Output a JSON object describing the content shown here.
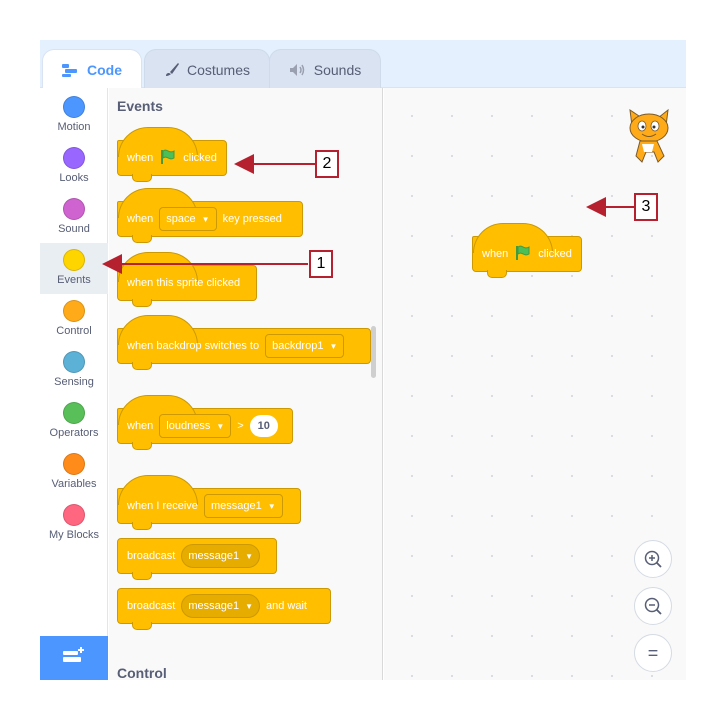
{
  "tabs": [
    {
      "label": "Code",
      "icon": "code-icon",
      "active": true
    },
    {
      "label": "Costumes",
      "icon": "brush-icon",
      "active": false
    },
    {
      "label": "Sounds",
      "icon": "speaker-icon",
      "active": false
    }
  ],
  "categories": [
    {
      "label": "Motion",
      "color": "#4c97ff"
    },
    {
      "label": "Looks",
      "color": "#9966ff"
    },
    {
      "label": "Sound",
      "color": "#cf63cf"
    },
    {
      "label": "Events",
      "color": "#ffd500",
      "active": true
    },
    {
      "label": "Control",
      "color": "#ffab19"
    },
    {
      "label": "Sensing",
      "color": "#5cb1d6"
    },
    {
      "label": "Operators",
      "color": "#59c059"
    },
    {
      "label": "Variables",
      "color": "#ff8c1a"
    },
    {
      "label": "My Blocks",
      "color": "#ff6680"
    }
  ],
  "palette": {
    "section_title": "Events",
    "next_section_title": "Control",
    "blocks": {
      "green_flag": {
        "when": "when",
        "clicked": "clicked"
      },
      "key_pressed": {
        "when": "when",
        "key": "space",
        "suffix": "key pressed"
      },
      "sprite_clicked": {
        "label": "when this sprite clicked"
      },
      "backdrop_switch": {
        "label": "when backdrop switches to",
        "value": "backdrop1"
      },
      "loudness": {
        "when": "when",
        "sensor": "loudness",
        "op": ">",
        "value": "10"
      },
      "receive": {
        "label": "when I receive",
        "message": "message1"
      },
      "broadcast": {
        "label": "broadcast",
        "message": "message1"
      },
      "broadcast_wait": {
        "label": "broadcast",
        "message": "message1",
        "suffix": "and wait"
      }
    }
  },
  "workspace": {
    "script_block": {
      "when": "when",
      "clicked": "clicked"
    },
    "zoom_in_symbol": "+",
    "zoom_out_symbol": "−",
    "zoom_reset_symbol": "="
  },
  "annotations": [
    "1",
    "2",
    "3"
  ],
  "colors": {
    "accent": "#4c97ff",
    "events": "#ffbf00",
    "annotation": "#b5212e"
  }
}
